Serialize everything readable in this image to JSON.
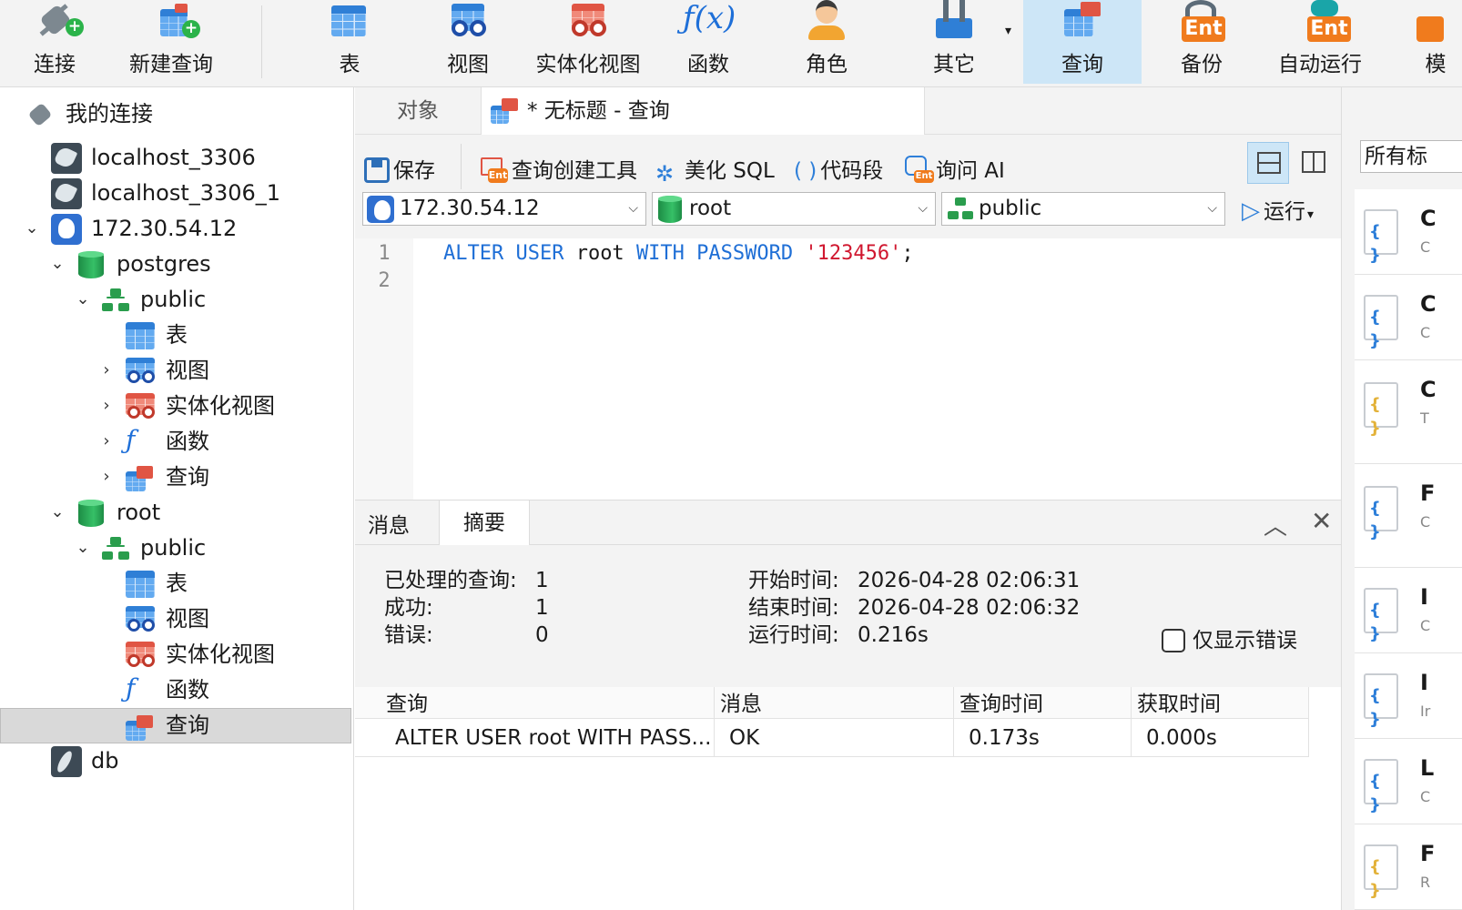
{
  "toolbar": {
    "connect": "连接",
    "new_query": "新建查询",
    "table": "表",
    "view": "视图",
    "mat_view": "实体化视图",
    "function": "函数",
    "role": "角色",
    "other": "其它",
    "query": "查询",
    "backup": "备份",
    "automation": "自动运行",
    "model_partial": "模",
    "ent_badge": "Ent",
    "fx_glyph": "ƒ(x)"
  },
  "tree": {
    "root_label": "我的连接",
    "items": [
      {
        "label": "localhost_3306"
      },
      {
        "label": "localhost_3306_1"
      },
      {
        "label": "172.30.54.12"
      },
      {
        "label": "postgres"
      },
      {
        "label": "public"
      },
      {
        "label": "表"
      },
      {
        "label": "视图"
      },
      {
        "label": "实体化视图"
      },
      {
        "label": "函数"
      },
      {
        "label": "查询"
      },
      {
        "label": "root"
      },
      {
        "label": "public"
      },
      {
        "label": "表"
      },
      {
        "label": "视图"
      },
      {
        "label": "实体化视图"
      },
      {
        "label": "函数"
      },
      {
        "label": "查询"
      },
      {
        "label": "db"
      }
    ]
  },
  "tabs": {
    "objects": "对象",
    "query_tab": "* 无标题 - 查询"
  },
  "qtoolbar": {
    "save": "保存",
    "builder": "查询创建工具",
    "beautify": "美化 SQL",
    "snippet": "代码段",
    "ask_ai": "询问 AI",
    "run": "运行",
    "connection": "172.30.54.12",
    "database": "root",
    "schema": "public"
  },
  "editor": {
    "line_numbers": [
      "1",
      "2"
    ],
    "code": {
      "kw1": "ALTER USER",
      "ident": " root ",
      "kw2": "WITH PASSWORD",
      "space": " ",
      "str": "'123456'",
      "end": ";"
    }
  },
  "result": {
    "tab_message": "消息",
    "tab_summary": "摘要",
    "processed_label": "已处理的查询:",
    "processed_value": "1",
    "success_label": "成功:",
    "success_value": "1",
    "error_label": "错误:",
    "error_value": "0",
    "start_label": "开始时间:",
    "start_value": "2026-04-28 02:06:31",
    "end_label": "结束时间:",
    "end_value": "2026-04-28 02:06:32",
    "elapsed_label": "运行时间:",
    "elapsed_value": "0.216s",
    "only_errors": "仅显示错误",
    "columns": [
      "查询",
      "消息",
      "查询时间",
      "获取时间"
    ],
    "row": [
      "ALTER USER root WITH PASS...",
      "OK",
      "0.173s",
      "0.000s"
    ]
  },
  "right_panel": {
    "filter": "所有标",
    "cards": [
      {
        "t1": "C",
        "t2": "C"
      },
      {
        "t1": "C",
        "t2": "C"
      },
      {
        "t1": "C",
        "t2": "T"
      },
      {
        "t1": "F",
        "t2": "C"
      },
      {
        "t1": "I",
        "t2": "C"
      },
      {
        "t1": "I",
        "t2": "Ir"
      },
      {
        "t1": "L",
        "t2": "C"
      },
      {
        "t1": "F",
        "t2": "R"
      }
    ]
  },
  "colors": {
    "active_tab": "#cde6f7",
    "keyword": "#1f6fd6",
    "string": "#d0172f",
    "selected_row": "#d9d9d9"
  }
}
